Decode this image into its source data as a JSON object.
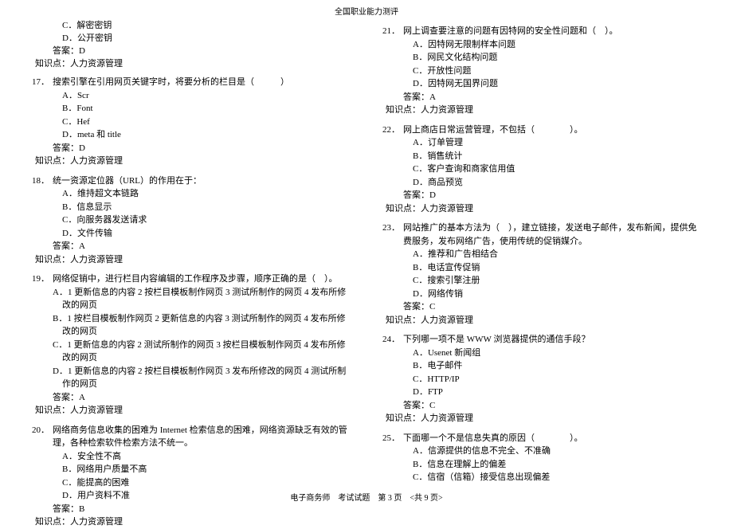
{
  "header": "全国职业能力测评",
  "footer": "电子商务师　考试试题　第 3 页　<共 9 页>",
  "left": {
    "partialTop": {
      "opts": [
        "C．解密密钥",
        "D．公开密钥"
      ],
      "answer": "答案：D",
      "kp": "知识点：人力资源管理"
    },
    "questions": [
      {
        "num": "17．",
        "stem": "搜索引擎在引用网页关键字时，将要分析的栏目是（　　　）",
        "opts": [
          "A．Scr",
          "B．Font",
          "C．Hef",
          "D．meta 和 title"
        ],
        "answer": "答案：D",
        "kp": "知识点：人力资源管理"
      },
      {
        "num": "18．",
        "stem": "统一资源定位器（URL）的作用在于：",
        "opts": [
          "A．维持超文本链路",
          "B．信息显示",
          "C．向服务器发送请求",
          "D．文件传输"
        ],
        "answer": "答案：A",
        "kp": "知识点：人力资源管理"
      },
      {
        "num": "19．",
        "stem": "网络促销中，进行栏目内容编辑的工作程序及步骤，顺序正确的是（　）。",
        "opts": [
          "A．1 更新信息的内容 2 按栏目模板制作网页 3 测试所制作的网页 4 发布所修改的网页",
          "B．1 按栏目模板制作网页 2 更新信息的内容 3 测试所制作的网页 4 发布所修改的网页",
          "C．1 更新信息的内容 2 测试所制作的网页 3 按栏目模板制作网页 4 发布所修改的网页",
          "D．1 更新信息的内容 2 按栏目模板制作网页 3 发布所修改的网页 4 测试所制作的网页"
        ],
        "answer": "答案：A",
        "kp": "知识点：人力资源管理"
      },
      {
        "num": "20．",
        "stem": "网络商务信息收集的困难为 Internet 检索信息的困难，网络资源缺乏有效的管理，各种检索软件检索方法不统一。",
        "opts": [
          "A．安全性不高",
          "B．网络用户质量不高",
          "C．能提高的困难",
          "D．用户资料不准"
        ],
        "answer": "答案：B",
        "kp": "知识点：人力资源管理"
      }
    ]
  },
  "right": {
    "questions": [
      {
        "num": "21．",
        "stem": "网上调查要注意的问题有因特网的安全性问题和（　）。",
        "opts": [
          "A．因特网无限制样本问题",
          "B．网民文化结构问题",
          "C．开放性问题",
          "D．因特网无国界问题"
        ],
        "answer": "答案：A",
        "kp": "知识点：人力资源管理"
      },
      {
        "num": "22．",
        "stem": "网上商店日常运营管理，不包括（　　　　）。",
        "opts": [
          "A．订单管理",
          "B．销售统计",
          "C．客户查询和商家信用值",
          "D．商品预览"
        ],
        "answer": "答案：D",
        "kp": "知识点：人力资源管理"
      },
      {
        "num": "23．",
        "stem": "网站推广的基本方法为（　），建立链接，发送电子邮件，发布新闻，提供免费服务，发布网络广告，使用传统的促销媒介。",
        "opts": [
          "A．推荐和广告相结合",
          "B．电话宣传促销",
          "C．搜索引擎注册",
          "D．网络传销"
        ],
        "answer": "答案：C",
        "kp": "知识点：人力资源管理"
      },
      {
        "num": "24．",
        "stem": "下列哪一项不是 WWW 浏览器提供的通信手段？",
        "opts": [
          "A．Usenet 新闻组",
          "B．电子邮件",
          "C．HTTP/IP",
          "D．FTP"
        ],
        "answer": "答案：C",
        "kp": "知识点：人力资源管理"
      },
      {
        "num": "25．",
        "stem": "下面哪一个不是信息失真的原因（　　　　）。",
        "opts": [
          "A．信源提供的信息不完全、不准确",
          "B．信息在理解上的偏差",
          "C．信宿（信箱）接受信息出现偏差"
        ]
      }
    ]
  }
}
